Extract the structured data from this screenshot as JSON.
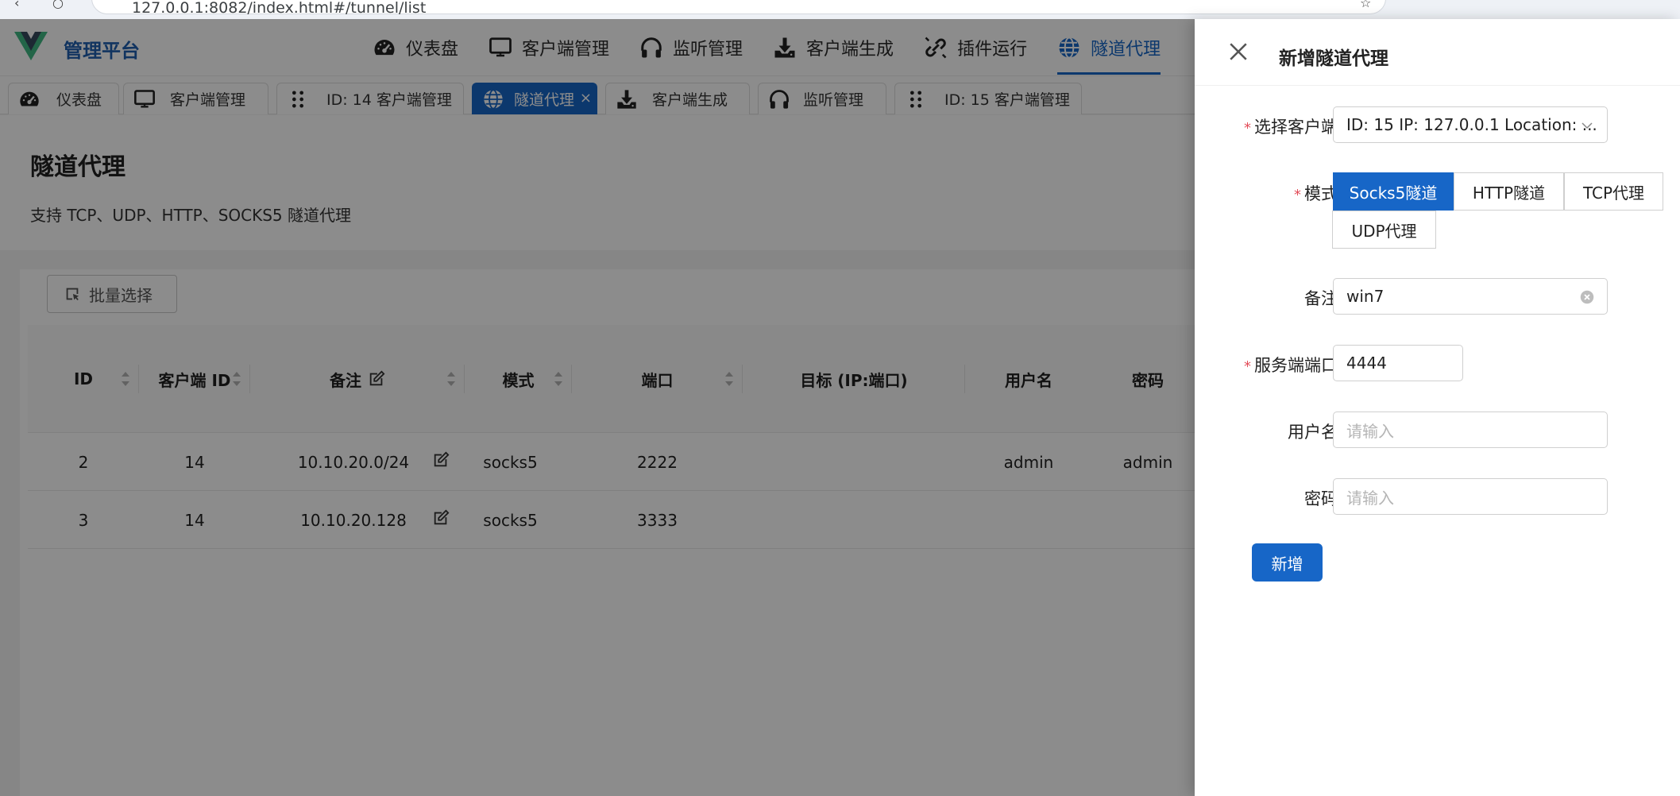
{
  "browser": {
    "url": "127.0.0.1:8082/index.html#/tunnel/list"
  },
  "brand": {
    "name": "管理平台",
    "accent": "#1766c7"
  },
  "nav": [
    {
      "label": "仪表盘",
      "icon": "dashboard-gauge-icon"
    },
    {
      "label": "客户端管理",
      "icon": "monitor-icon"
    },
    {
      "label": "监听管理",
      "icon": "headphones-icon"
    },
    {
      "label": "客户端生成",
      "icon": "download-icon"
    },
    {
      "label": "插件运行",
      "icon": "plugin-link-icon"
    },
    {
      "label": "隧道代理",
      "icon": "globe-icon",
      "active": true
    }
  ],
  "tabs": [
    {
      "label": "仪表盘",
      "icon": "dashboard-gauge-icon"
    },
    {
      "label": "客户端管理",
      "icon": "monitor-icon"
    },
    {
      "label": "ID: 14 客户端管理",
      "icon": "drag-grip-icon"
    },
    {
      "label": "隧道代理",
      "icon": "globe-icon",
      "active": true,
      "close": "×"
    },
    {
      "label": "客户端生成",
      "icon": "download-icon"
    },
    {
      "label": "监听管理",
      "icon": "headphones-icon"
    },
    {
      "label": "ID: 15 客户端管理",
      "icon": "drag-grip-icon"
    }
  ],
  "page": {
    "title": "隧道代理",
    "desc": "支持 TCP、UDP、HTTP、SOCKS5 隧道代理"
  },
  "batch_select": "批量选择",
  "table": {
    "columns": [
      "ID",
      "客户端 ID",
      "备注",
      "模式",
      "端口",
      "目标 (IP:端口)",
      "用户名",
      "密码"
    ],
    "rows": [
      {
        "id": "2",
        "client_id": "14",
        "remark": "10.10.20.0/24",
        "mode": "socks5",
        "port": "2222",
        "target": "",
        "username": "admin",
        "password": "admin"
      },
      {
        "id": "3",
        "client_id": "14",
        "remark": "10.10.20.128",
        "mode": "socks5",
        "port": "3333",
        "target": "",
        "username": "",
        "password": ""
      }
    ]
  },
  "drawer": {
    "title": "新增隧道代理",
    "labels": {
      "client": "选择客户端",
      "mode": "模式",
      "remark": "备注",
      "server_port": "服务端端口",
      "username": "用户名",
      "password": "密码"
    },
    "client_value": "ID: 15 IP: 127.0.0.1 Location: ...",
    "modes": [
      "Socks5隧道",
      "HTTP隧道",
      "TCP代理",
      "UDP代理"
    ],
    "selected_mode": "Socks5隧道",
    "remark_value": "win7",
    "server_port_value": "4444",
    "username_placeholder": "请输入",
    "password_placeholder": "请输入",
    "submit": "新增",
    "required_mark": "*",
    "required_color": "#e34d59"
  }
}
